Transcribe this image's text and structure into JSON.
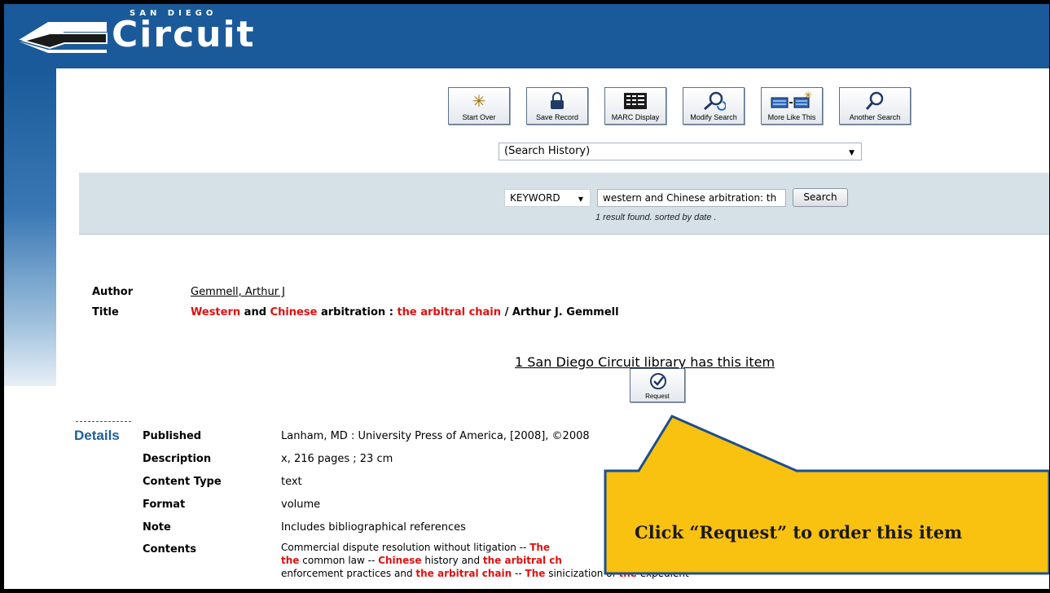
{
  "header": {
    "logo_sub": "SAN DIEGO",
    "logo_main": "Circuit",
    "colors": {
      "band": "#1a5a9a",
      "accent_red": "#e01010",
      "callout": "#f9c110"
    }
  },
  "toolbar": {
    "buttons": [
      {
        "label": "Start Over",
        "icon": "star-burst-icon"
      },
      {
        "label": "Save Record",
        "icon": "lock-icon"
      },
      {
        "label": "MARC Display",
        "icon": "marc-grid-icon"
      },
      {
        "label": "Modify Search",
        "icon": "magnifier-refresh-icon"
      },
      {
        "label": "More Like This",
        "icon": "records-star-icon"
      },
      {
        "label": "Another Search",
        "icon": "magnifier-icon"
      }
    ],
    "history_selected": "(Search History)"
  },
  "search": {
    "type_selected": "KEYWORD",
    "query": "western and Chinese arbitration: th",
    "button_label": "Search",
    "result_note": "1 result found. sorted by date ."
  },
  "record": {
    "author_label": "Author",
    "author": "Gemmell, Arthur J",
    "title_label": "Title",
    "title": {
      "w1": "Western",
      "t1": "and",
      "w2": "Chinese",
      "t2": "arbitration :",
      "w3": "the arbitral chain",
      "t3": "/ Arthur J. Gemmell"
    },
    "holdings": "1 San Diego Circuit library has this item",
    "request_label": "Request"
  },
  "details": {
    "heading": "Details",
    "rows": [
      {
        "label": "Published",
        "value": "Lanham, MD : University Press of America, [2008], ©2008"
      },
      {
        "label": "Description",
        "value": "x, 216 pages ; 23 cm"
      },
      {
        "label": "Content Type",
        "value": "text"
      },
      {
        "label": "Format",
        "value": "volume"
      },
      {
        "label": "Note",
        "value": "Includes bibliographical references"
      },
      {
        "label": "Contents",
        "value": ""
      }
    ],
    "contents": {
      "p1": "Commercial dispute resolution without litigation --",
      "h1": "The",
      "h2": "the",
      "p2": "common law --",
      "h3": "Chinese",
      "p3": "history and",
      "h4": "the arbitral ch",
      "p4": "enforcement practices and",
      "h5": "the arbitral chain",
      "p5": "--",
      "h6": "The",
      "p6": "sinicization of",
      "h7": "the",
      "p7": "expedient"
    }
  },
  "callout": {
    "text": "Click “Request” to order this item"
  }
}
